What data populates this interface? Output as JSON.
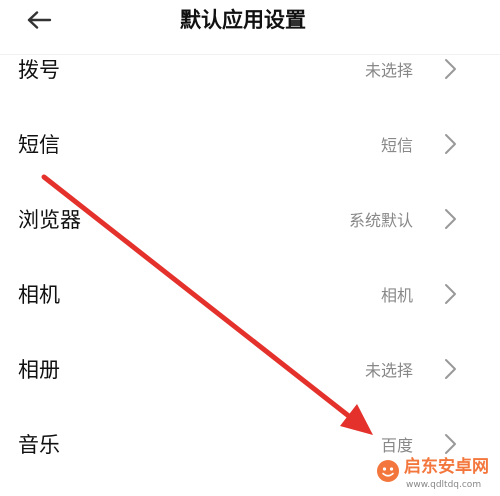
{
  "header": {
    "title": "默认应用设置",
    "back_icon": "arrow-left-icon"
  },
  "items": [
    {
      "label": "拨号",
      "value": "未选择"
    },
    {
      "label": "短信",
      "value": "短信"
    },
    {
      "label": "浏览器",
      "value": "系统默认"
    },
    {
      "label": "相机",
      "value": "相机"
    },
    {
      "label": "相册",
      "value": "未选择"
    },
    {
      "label": "音乐",
      "value": "百度"
    }
  ],
  "item_icon": "chevron-right-icon",
  "annotation": {
    "icon": "red-arrow-icon",
    "color": "#e4312b"
  },
  "watermark": {
    "name": "启东安卓网",
    "url": "www.qdltdq.com",
    "logo_icon": "logo-icon"
  },
  "colors": {
    "background": "#ffffff",
    "label": "#111111",
    "value": "#888888",
    "chevron": "#999999",
    "watermark": "#f26522"
  }
}
